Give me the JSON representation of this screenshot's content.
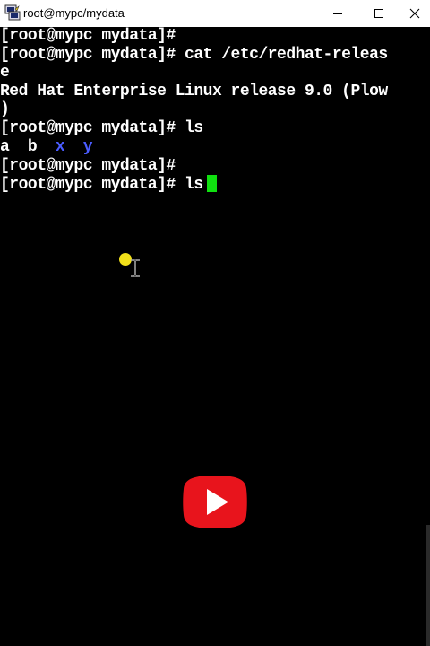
{
  "window": {
    "title": "root@mypc/mydata",
    "icons": {
      "app": "putty-terminal-icon",
      "minimize": "minimize-icon",
      "maximize": "maximize-icon",
      "close": "close-icon"
    }
  },
  "terminal": {
    "lines": [
      "[root@mypc mydata]#",
      "[root@mypc mydata]# cat /etc/redhat-releas",
      "e",
      "Red Hat Enterprise Linux release 9.0 (Plow",
      ")",
      "[root@mypc mydata]# ls"
    ],
    "ls_output": {
      "files": [
        "a",
        "b"
      ],
      "dirs": [
        "x",
        "y"
      ]
    },
    "after_ls": "[root@mypc mydata]#",
    "current_prompt": "[root@mypc mydata]# ls",
    "colors": {
      "background": "#000000",
      "text": "#ffffff",
      "directory": "#4a5cff",
      "cursor": "#10e010"
    }
  },
  "overlay": {
    "pointer_icon": "i-beam-cursor-icon",
    "highlight_icon": "click-highlight-icon",
    "badge_icon": "play-button-icon",
    "badge_color": "#e8141c"
  }
}
